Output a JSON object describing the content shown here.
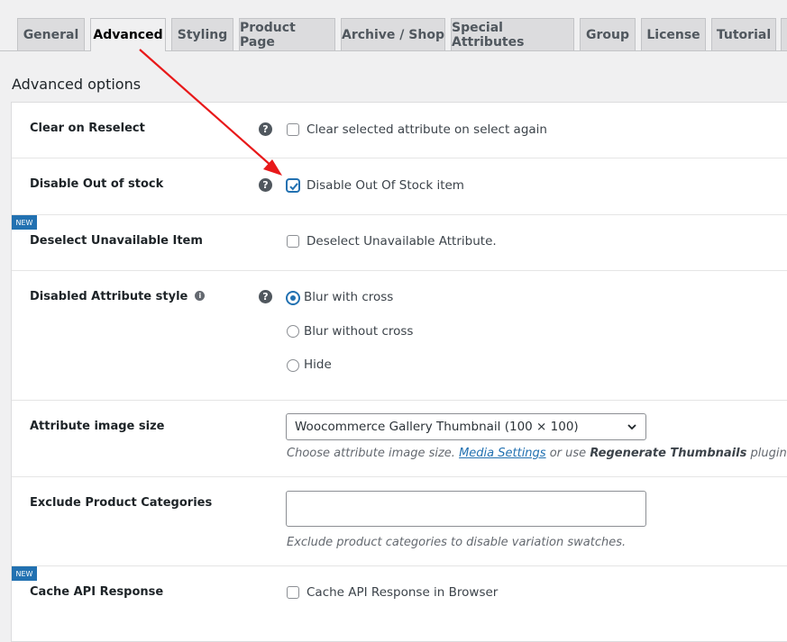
{
  "tabs": [
    "General",
    "Advanced",
    "Styling",
    "Product Page",
    "Archive / Shop",
    "Special Attributes",
    "Group",
    "License",
    "Tutorial"
  ],
  "active_tab": "Advanced",
  "section_title": "Advanced options",
  "help_icon_glyph": "?",
  "info_icon_glyph": "i",
  "new_badge": "NEW",
  "colors": {
    "accent": "#2271b1",
    "arrow": "#e8191a"
  },
  "rows": {
    "clear_on_reselect": {
      "label": "Clear on Reselect",
      "checkbox_label": "Clear selected attribute on select again",
      "checked": false
    },
    "disable_out_of_stock": {
      "label": "Disable Out of stock",
      "checkbox_label": "Disable Out Of Stock item",
      "checked": true
    },
    "deselect_unavailable": {
      "label": "Deselect Unavailable Item",
      "checkbox_label": "Deselect Unavailable Attribute.",
      "checked": false
    },
    "disabled_attribute_style": {
      "label": "Disabled Attribute style",
      "options": [
        "Blur with cross",
        "Blur without cross",
        "Hide"
      ],
      "selected": "Blur with cross"
    },
    "attribute_image_size": {
      "label": "Attribute image size",
      "selected": "Woocommerce Gallery Thumbnail (100 × 100)",
      "desc_prefix": "Choose attribute image size.",
      "desc_link": "Media Settings",
      "desc_mid": "or use",
      "desc_bold": "Regenerate Thumbnails",
      "desc_suffix": "plugin."
    },
    "exclude_categories": {
      "label": "Exclude Product Categories",
      "value": "",
      "desc": "Exclude product categories to disable variation swatches."
    },
    "cache_api": {
      "label": "Cache API Response",
      "checkbox_label": "Cache API Response in Browser",
      "checked": false
    }
  }
}
